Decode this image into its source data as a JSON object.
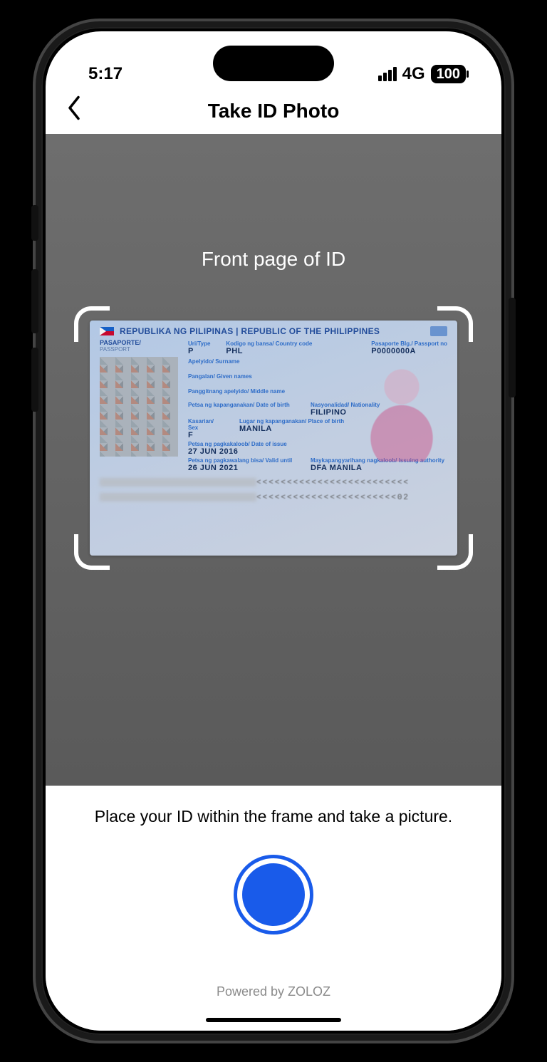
{
  "status": {
    "time": "5:17",
    "network": "4G",
    "battery": "100"
  },
  "nav": {
    "title": "Take ID Photo"
  },
  "camera": {
    "frame_label": "Front page of ID"
  },
  "passport": {
    "header": "REPUBLIKA NG PILIPINAS | REPUBLIC OF THE PHILIPPINES",
    "doc_label": "PASAPORTE/",
    "doc_label_en": "PASSPORT",
    "type_label": "Uri/Type",
    "type_value": "P",
    "country_label": "Kodigo ng bansa/ Country code",
    "country_value": "PHL",
    "passport_label": "Pasaporte Blg./ Passport no",
    "passport_value": "P0000000A",
    "surname_label": "Apelyido/ Surname",
    "given_label": "Pangalan/ Given names",
    "middle_label": "Panggitnang apelyido/ Middle name",
    "dob_label": "Petsa ng kapanganakan/ Date of birth",
    "nationality_label": "Nasyonalidad/ Nationality",
    "nationality_value": "FILIPINO",
    "sex_label": "Kasarian/ Sex",
    "sex_value": "F",
    "pob_label": "Lugar ng kapanganakan/ Place of birth",
    "pob_value": "MANILA",
    "issue_label": "Petsa ng pagkakaloob/ Date of issue",
    "issue_value": "27 JUN 2016",
    "expiry_label": "Petsa ng pagkawalang bisa/ Valid until",
    "expiry_value": "26 JUN 2021",
    "authority_label": "Maykapangyarihang nagkaloob/ Issuing authority",
    "authority_value": "DFA MANILA",
    "mrz1_tail": "<<<<<<<<<<<<<<<<<<<<<<<<<",
    "mrz2_tail": "<<<<<<<<<<<<<<<<<<<<<<<02"
  },
  "bottom": {
    "instruction": "Place your ID within the frame and take a picture.",
    "powered": "Powered by ZOLOZ"
  }
}
